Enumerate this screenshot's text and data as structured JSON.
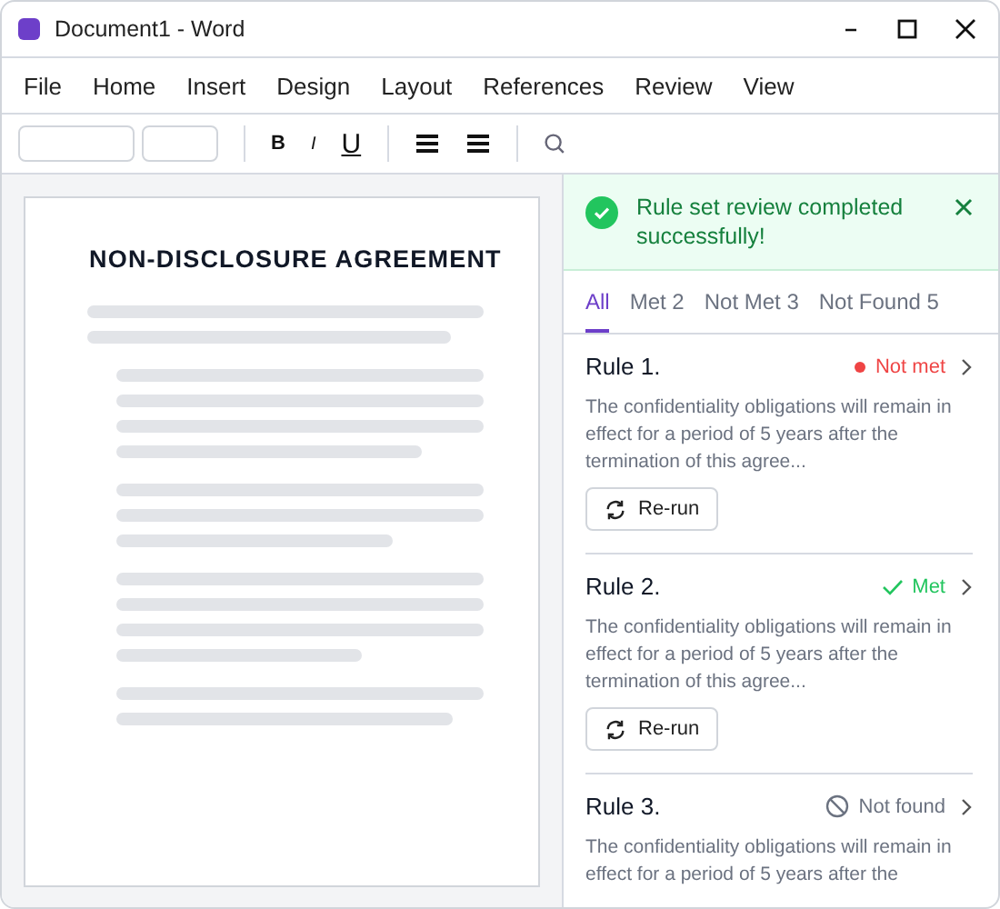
{
  "window": {
    "title": "Document1 - Word"
  },
  "menu": [
    "File",
    "Home",
    "Insert",
    "Design",
    "Layout",
    "References",
    "Review",
    "View"
  ],
  "toolbar": {
    "bold": "B",
    "italic": "I",
    "underline": "U"
  },
  "document": {
    "title": "NON-DISCLOSURE AGREEMENT"
  },
  "panel": {
    "banner": "Rule set review completed successfully!",
    "tabs": [
      {
        "label": "All",
        "selected": true
      },
      {
        "label": "Met 2",
        "selected": false
      },
      {
        "label": "Not Met 3",
        "selected": false
      },
      {
        "label": "Not Found 5",
        "selected": false
      }
    ],
    "rules": [
      {
        "title": "Rule 1.",
        "status": "Not met",
        "kind": "not_met",
        "text": "The confidentiality obligations will remain in effect for a period of 5 years after the termination of this agree...",
        "button": "Re-run"
      },
      {
        "title": "Rule 2.",
        "status": "Met",
        "kind": "met",
        "text": "The confidentiality obligations will remain in effect for a period of 5 years after the termination of this agree...",
        "button": "Re-run"
      },
      {
        "title": "Rule 3.",
        "status": "Not found",
        "kind": "not_found",
        "text": "The confidentiality obligations will remain in effect for a period of 5 years after the"
      }
    ]
  }
}
